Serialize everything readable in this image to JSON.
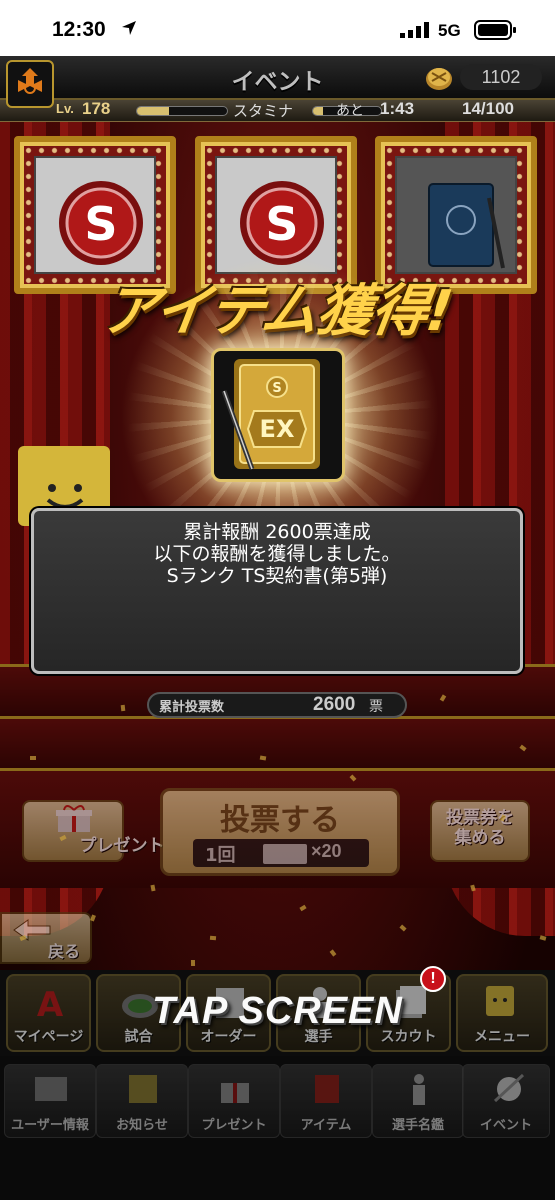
{
  "status_bar": {
    "time": "12:30",
    "network": "5G"
  },
  "header": {
    "title": "イベント",
    "coins": "1102"
  },
  "stats": {
    "level_label": "Lv.",
    "level": "178",
    "stamina_label": "スタミナ",
    "remaining_label": "あと",
    "timer": "1:43",
    "stamina": "14/100",
    "exp_fraction": 0.35,
    "stamina_fraction": 0.14
  },
  "reward": {
    "headline": "アイテム獲得!",
    "message_lines": [
      "累計報酬 2600票達成",
      "以下の報酬を獲得しました。",
      "Sランク TS契約書(第5弾)"
    ]
  },
  "votes": {
    "label": "累計投票数",
    "value": "2600",
    "unit": "票"
  },
  "actions": {
    "vote_label": "投票する",
    "vote_count": "1回",
    "vote_cost": "×20",
    "present_label": "プレゼント",
    "collect_label_1": "投票券を",
    "collect_label_2": "集める",
    "back_label": "戻る"
  },
  "tap_screen": "TAP SCREEN",
  "nav_main": {
    "items": [
      "マイページ",
      "試合",
      "オーダー",
      "選手",
      "スカウト",
      "メニュー"
    ],
    "badge": "!"
  },
  "nav_bottom": {
    "items": [
      "ユーザー情報",
      "お知らせ",
      "プレゼント",
      "アイテム",
      "選手名鑑",
      "イベント"
    ]
  },
  "colors": {
    "gold": "#ffd24a",
    "curtain": "#7c0f0c",
    "badge": "#c8101a"
  }
}
